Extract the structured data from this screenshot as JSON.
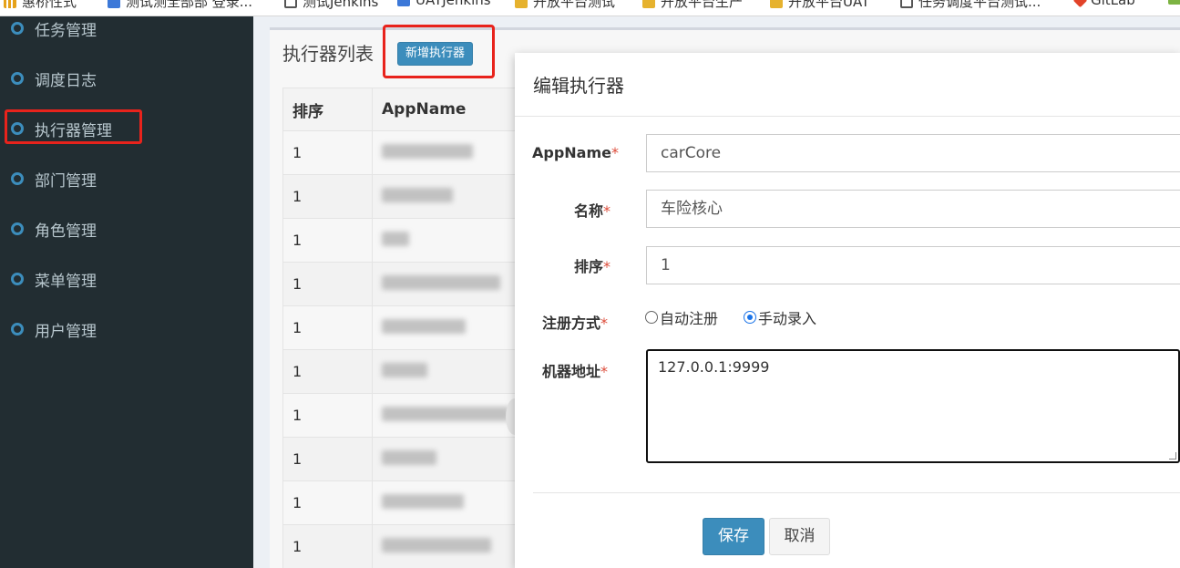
{
  "bookmarks": [
    {
      "label": "惠桥性式",
      "icon": "bars-icon"
    },
    {
      "label": "测试测全部部 登录...",
      "icon": "people-icon"
    },
    {
      "label": "测试Jenkins",
      "icon": "globe-icon"
    },
    {
      "label": "UATJenkins",
      "icon": "jenkins-icon"
    },
    {
      "label": "开放平台测试",
      "icon": "folder-icon"
    },
    {
      "label": "开放平台生产",
      "icon": "folder-icon"
    },
    {
      "label": "开放平台UAT",
      "icon": "folder-icon"
    },
    {
      "label": "任务调度平台测试...",
      "icon": "globe-icon"
    },
    {
      "label": "GitLab",
      "icon": "gitlab-icon"
    }
  ],
  "sidebar": {
    "items": [
      {
        "label": "任务管理"
      },
      {
        "label": "调度日志"
      },
      {
        "label": "执行器管理"
      },
      {
        "label": "部门管理"
      },
      {
        "label": "角色管理"
      },
      {
        "label": "菜单管理"
      },
      {
        "label": "用户管理"
      }
    ],
    "active_index": 2
  },
  "main": {
    "title": "执行器列表",
    "add_button": "新增执行器",
    "table": {
      "columns": [
        "排序",
        "AppName"
      ],
      "rows": [
        {
          "order": "1"
        },
        {
          "order": "1"
        },
        {
          "order": "1"
        },
        {
          "order": "1"
        },
        {
          "order": "1"
        },
        {
          "order": "1"
        },
        {
          "order": "1"
        },
        {
          "order": "1"
        },
        {
          "order": "1"
        },
        {
          "order": "1"
        }
      ]
    }
  },
  "modal": {
    "title": "编辑执行器",
    "fields": {
      "appname": {
        "label": "AppName",
        "value": "carCore"
      },
      "name": {
        "label": "名称",
        "value": "车险核心"
      },
      "order": {
        "label": "排序",
        "value": "1"
      },
      "register": {
        "label": "注册方式",
        "options": [
          "自动注册",
          "手动录入"
        ],
        "selected": "手动录入"
      },
      "address": {
        "label": "机器地址",
        "value": "127.0.0.1:9999"
      }
    },
    "required_mark": "*",
    "save": "保存",
    "cancel": "取消"
  },
  "colors": {
    "sidebar_bg": "#222d32",
    "accent": "#3c8dbc",
    "highlight": "#e8231c",
    "required": "#dd4b39"
  }
}
